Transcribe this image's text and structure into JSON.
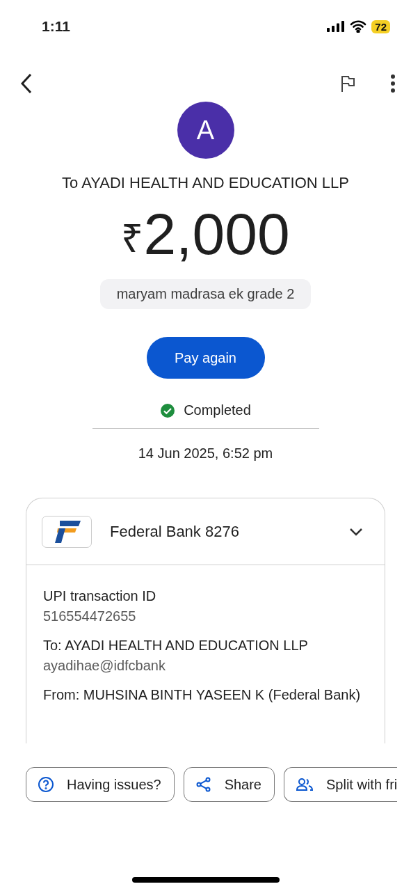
{
  "status_bar": {
    "time": "1:11",
    "battery": "72"
  },
  "recipient": {
    "initial": "A",
    "title": "To AYADI HEALTH AND EDUCATION LLP"
  },
  "amount": {
    "currency": "₹",
    "value": "2,000"
  },
  "note": "maryam madrasa ek grade 2",
  "pay_button": "Pay again",
  "status": {
    "label": "Completed",
    "kind": "success"
  },
  "date": "14 Jun 2025, 6:52 pm",
  "account": {
    "name": "Federal Bank 8276",
    "expanded": false
  },
  "details": [
    {
      "label": "UPI transaction ID",
      "value": "516554472655"
    },
    {
      "label": "To: AYADI HEALTH AND EDUCATION LLP",
      "value": "ayadihae@idfcbank"
    },
    {
      "label": "From: MUHSINA BINTH YASEEN K (Federal Bank)"
    }
  ],
  "actions": [
    {
      "kind": "help",
      "label": "Having issues?"
    },
    {
      "kind": "share",
      "label": "Share"
    },
    {
      "kind": "split",
      "label": "Split with fri"
    }
  ]
}
